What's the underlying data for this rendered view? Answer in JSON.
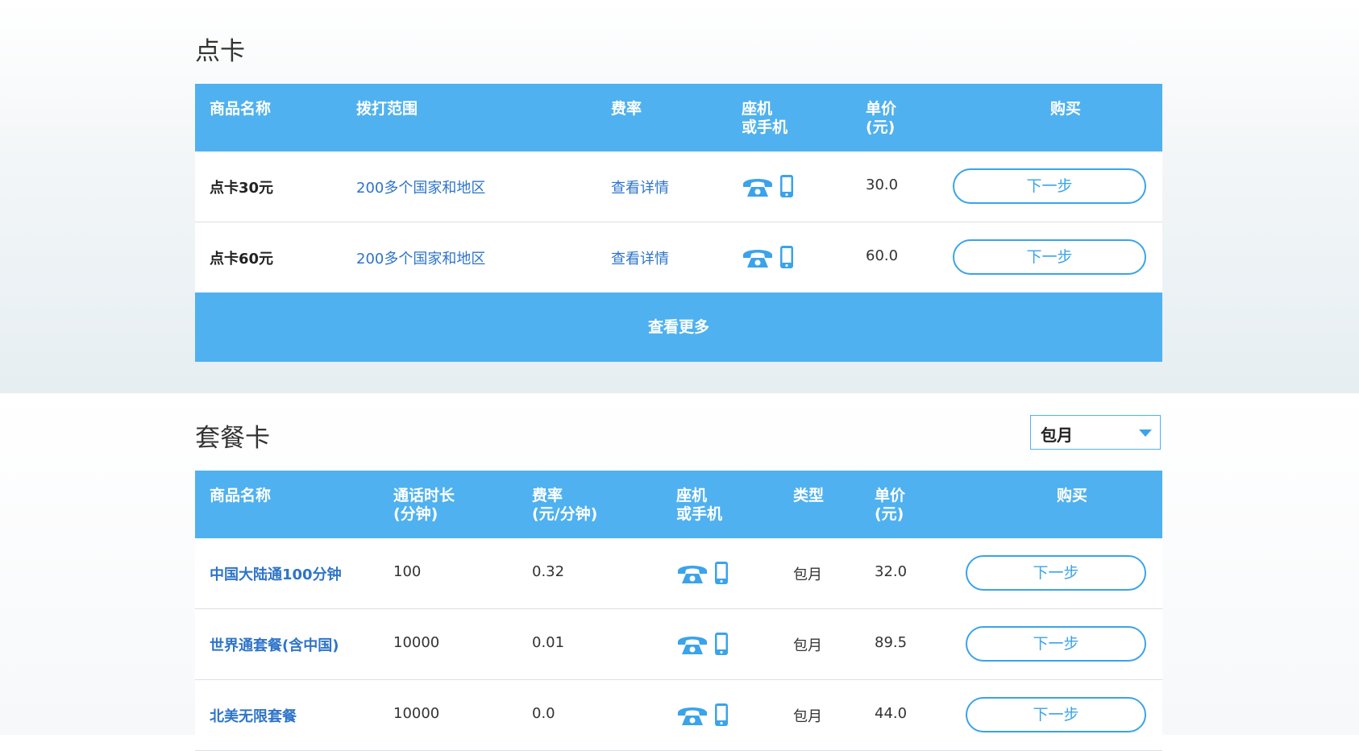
{
  "pay_card": {
    "title": "点卡",
    "headers": {
      "name": "商品名称",
      "range": "拨打范围",
      "rate": "费率",
      "device_line1": "座机",
      "device_line2": "或手机",
      "price_line1": "单价",
      "price_line2": "(元)",
      "buy": "购买"
    },
    "rows": [
      {
        "name": "点卡30元",
        "range": "200多个国家和地区",
        "rate": "查看详情",
        "price": "30.0",
        "button": "下一步"
      },
      {
        "name": "点卡60元",
        "range": "200多个国家和地区",
        "rate": "查看详情",
        "price": "60.0",
        "button": "下一步"
      }
    ],
    "more_label": "查看更多"
  },
  "package_card": {
    "title": "套餐卡",
    "filter": {
      "selected": "包月"
    },
    "headers": {
      "name": "商品名称",
      "duration_line1": "通话时长",
      "duration_line2": "(分钟)",
      "rate_line1": "费率",
      "rate_line2": "(元/分钟)",
      "device_line1": "座机",
      "device_line2": "或手机",
      "type": "类型",
      "price_line1": "单价",
      "price_line2": "(元)",
      "buy": "购买"
    },
    "rows": [
      {
        "name": "中国大陆通100分钟",
        "duration": "100",
        "rate": "0.32",
        "type": "包月",
        "price": "32.0",
        "button": "下一步"
      },
      {
        "name": "世界通套餐(含中国)",
        "duration": "10000",
        "rate": "0.01",
        "type": "包月",
        "price": "89.5",
        "button": "下一步"
      },
      {
        "name": "北美无限套餐",
        "duration": "10000",
        "rate": "0.0",
        "type": "包月",
        "price": "44.0",
        "button": "下一步"
      }
    ]
  },
  "icons": {
    "landline": "landline-phone-icon",
    "mobile": "mobile-phone-icon"
  },
  "colors": {
    "accent": "#4fb1ef",
    "link": "#2e74c9",
    "button_border": "#3aa3ea"
  }
}
